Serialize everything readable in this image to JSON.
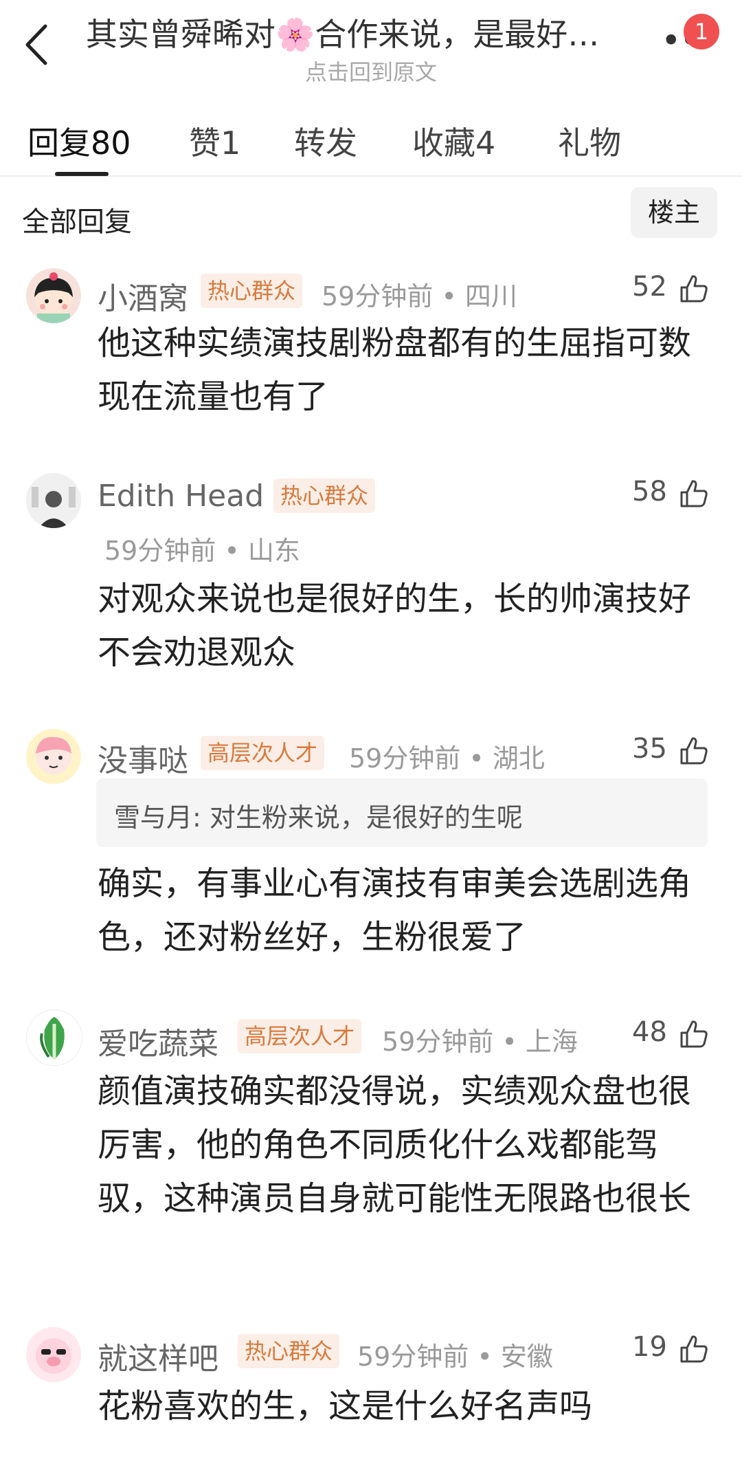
{
  "header": {
    "title": "其实曾舜晞对🌸合作来说，是最好…",
    "subtitle": "点击回到原文",
    "notification_count": "1",
    "more_label": "••"
  },
  "tabs": [
    {
      "label": "回复80"
    },
    {
      "label": "赞1"
    },
    {
      "label": "转发"
    },
    {
      "label": "收藏4"
    },
    {
      "label": "礼物"
    }
  ],
  "filter": {
    "label": "全部回复",
    "owner_button": "楼主"
  },
  "comments": [
    {
      "name": "小酒窝",
      "tag": "热心群众",
      "meta": "59分钟前 • 四川",
      "likes": "52",
      "text": "他这种实绩演技剧粉盘都有的生屈指可数 现在流量也有了"
    },
    {
      "name": "Edith Head",
      "tag": "热心群众",
      "meta": "59分钟前 • 山东",
      "likes": "58",
      "text": "对观众来说也是很好的生，长的帅演技好不会劝退观众"
    },
    {
      "name": "没事哒",
      "tag": "高层次人才",
      "meta": "59分钟前 • 湖北",
      "likes": "35",
      "quote": "雪与月: 对生粉来说，是很好的生呢",
      "text": "确实，有事业心有演技有审美会选剧选角色，还对粉丝好，生粉很爱了"
    },
    {
      "name": "爱吃蔬菜",
      "tag": "高层次人才",
      "meta": "59分钟前 • 上海",
      "likes": "48",
      "text": "颜值演技确实都没得说，实绩观众盘也很厉害，他的角色不同质化什么戏都能驾驭，这种演员自身就可能性无限路也很长"
    },
    {
      "name": "就这样吧",
      "tag": "热心群众",
      "meta": "59分钟前 • 安徽",
      "likes": "19",
      "text": "花粉喜欢的生，这是什么好名声吗"
    }
  ],
  "colors": {
    "tag_bg": "#fbeee6",
    "tag_text": "#d77a3e",
    "badge": "#f05050"
  }
}
